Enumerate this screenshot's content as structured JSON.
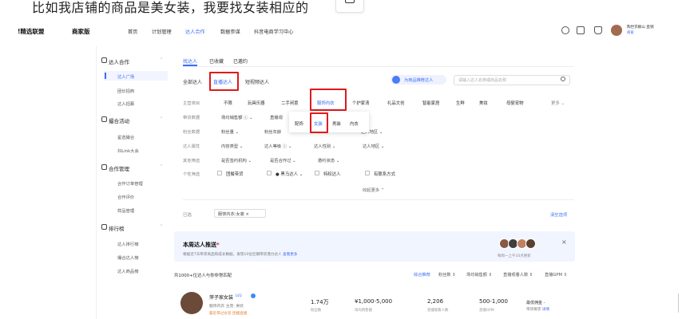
{
  "caption": {
    "text": "比如我店铺的商品是美女装，我要找女装相应的"
  },
  "topnav": {
    "brand": "!精选联盟",
    "brand_sub": "商家版",
    "items": [
      "首页",
      "计划管理",
      "达人合作",
      "数据参谋",
      "抖音电商学习中心"
    ],
    "active_index": 2,
    "user_name": "陶世衣橱山 直销",
    "user_tag": "商家"
  },
  "sidebar": {
    "sections": [
      {
        "title": "达人合作",
        "icon": "users-icon",
        "items": [
          "达人广场",
          "团长招商",
          "达人招募"
        ]
      },
      {
        "title": "撮合活动",
        "icon": "activity-icon",
        "items": [
          "星选撮合",
          "抖Link大会"
        ]
      },
      {
        "title": "合作管理",
        "icon": "handshake-icon",
        "items": [
          "合作订单管理",
          "合作评价",
          "样品管理"
        ]
      },
      {
        "title": "排行榜",
        "icon": "trophy-icon",
        "items": [
          "达人排行榜",
          "撮合达人榜",
          "达人商品榜"
        ]
      }
    ],
    "active_item": "达人广场"
  },
  "tabs": {
    "items": [
      "找达人",
      "已收藏",
      "已邀约"
    ],
    "active_index": 0
  },
  "subtabs": {
    "items": [
      "全部达人",
      "直播达人",
      "短视频达人"
    ],
    "active_index": 1
  },
  "promo": {
    "label": "为商品推荐达人"
  },
  "search": {
    "placeholder": "请输入达人名称或商品名称"
  },
  "filters": {
    "category_label": "主营类目",
    "categories": [
      "不限",
      "玩具乐器",
      "二手闲置",
      "服饰内衣",
      "个护家清",
      "礼品文创",
      "智能家居",
      "生鲜",
      "美妆",
      "母婴宠物"
    ],
    "more": "更多",
    "sales_label": "带货数据",
    "sales_selects": [
      "场均销售额",
      "直播观"
    ],
    "fans_label": "粉丝数据",
    "fans_selects": [
      "粉丝量",
      "粉丝年龄"
    ],
    "attr_label": "达人属性",
    "attr_selects": [
      "内容类型",
      "达人等级",
      "达人性别",
      "达人地区"
    ],
    "region_select": "达人地区",
    "other_label": "其他筛选",
    "other_selects": [
      "是否签约机构",
      "是否合作过",
      "邀约状态"
    ],
    "personal_label": "个性筛选",
    "personal_checks": [
      "团餐带货",
      "黑马达人",
      "特权达人",
      "有联系方式"
    ],
    "collapse": "收起更多"
  },
  "dropdown": {
    "items": [
      "配饰",
      "女装",
      "男装",
      "内衣"
    ],
    "active_index": 1
  },
  "selected": {
    "label": "已选",
    "chip": "服饰内衣:女装",
    "clear": "清空选项"
  },
  "banner": {
    "title": "本周达人推送",
    "star": "*",
    "subtitle": "根据近7天带货商品和成长数据，发现10位近期带货潜力达人",
    "subtitle_link": "查看更多",
    "update": "每周一上午10点更新",
    "close": "×",
    "avatar_colors": [
      "#8a5a44",
      "#3f3f3f",
      "#c08060",
      "#5a4030"
    ]
  },
  "results": {
    "count": "共1000+位达人与你非常匹配",
    "sorts": [
      "综合推荐",
      "粉丝数",
      "场均销售额",
      "直播观看人数",
      "直播GPM"
    ],
    "active_sort": 0
  },
  "row": {
    "name": "萍子家女装",
    "badge": "LV2",
    "meta": "服饰内衣  主营: 男装",
    "tag": "最近带过女装  团播直播",
    "fans": "1.74万",
    "fans_cap": "粉丝数",
    "sales": "¥1,000-5,000",
    "sales_cap": "场均销售额",
    "viewers": "2,206",
    "viewers_cap": "直播观看人数",
    "gpm": "500-1,000",
    "gpm_cap": "直播GPM",
    "extra1": "最低佣金 -",
    "extra2": "带货要求",
    "extra2_link": "详情"
  }
}
